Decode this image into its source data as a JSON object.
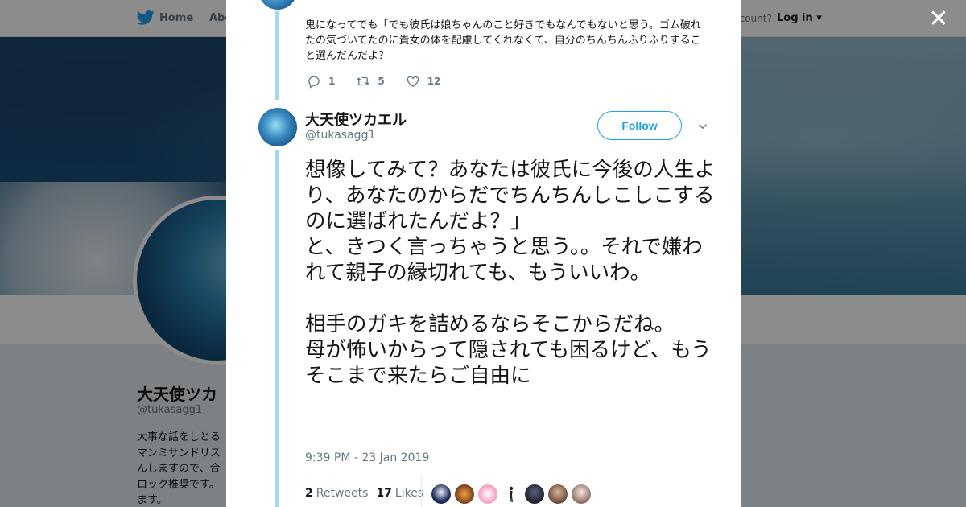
{
  "background_page": {
    "nav": {
      "home_label": "Home",
      "about_label": "Abo",
      "account_prompt": "ccount?",
      "login_label": "Log in"
    },
    "profile": {
      "name": "大天使ツカ",
      "handle": "@tukasagg1",
      "bio": "大事な話をしとる マンミサンドリス んしますので、合 ロック推奨です。 ます。"
    }
  },
  "modal": {
    "close_label": "✕",
    "previous_tweet": {
      "text": "鬼になってでも「でも彼氏は娘ちゃんのこと好きでもなんでもないと思う。ゴム破れたの気づいてたのに貴女の体を配慮してくれなくて、自分のちんちんふりふりすること選んだんだよ？",
      "replies": "1",
      "retweets": "5",
      "likes": "12"
    },
    "tweet": {
      "author_name": "大天使ツカエル",
      "author_handle": "@tukasagg1",
      "follow_label": "Follow",
      "text": "想像してみて？あなたは彼氏に今後の人生より、あなたのからだでちんちんしこしこするのに選ばれたんだよ？」\nと、きつく言っちゃうと思う。。それで嫌われて親子の縁切れても、もういいわ。\n\n相手のガキを詰めるならそこからだね。\n母が怖いからって隠されても困るけど、もうそこまで来たらご自由に",
      "timestamp": "9:39 PM - 23 Jan 2019",
      "retweet_count": "2",
      "retweet_label": "Retweets",
      "like_count": "17",
      "like_label": "Likes"
    }
  },
  "colors": {
    "twitter_blue": "#1da1f2",
    "thread_line": "#a3d7f2",
    "secondary_text": "#657786",
    "primary_text": "#14171a"
  },
  "icons": [
    "twitter-bird-icon",
    "close-icon",
    "reply-icon",
    "retweet-icon",
    "like-icon",
    "chevron-down-icon"
  ]
}
